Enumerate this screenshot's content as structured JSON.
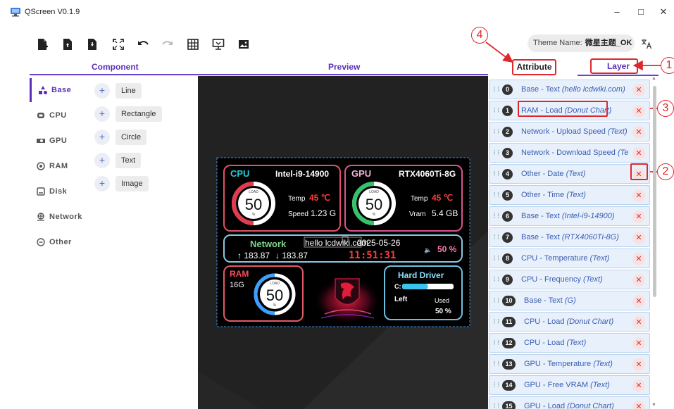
{
  "window": {
    "title": "QScreen V0.1.9",
    "minimize_glyph": "–",
    "maximize_glyph": "□",
    "close_glyph": "✕"
  },
  "toolbar": {
    "icons": [
      "new-file-icon",
      "open-file-icon",
      "save-file-icon",
      "fullscreen-icon",
      "undo-icon",
      "redo-icon",
      "grid-icon",
      "display-icon",
      "image-icon"
    ],
    "theme_label": "Theme Name:",
    "theme_value": "微星主题_OK",
    "translate_icon": "translate-icon"
  },
  "headers": {
    "component": "Component",
    "preview": "Preview",
    "attribute": "Attribute",
    "layer": "Layer"
  },
  "annotations": [
    "1",
    "2",
    "3",
    "4"
  ],
  "sidebar": {
    "items": [
      {
        "label": "Base",
        "icon": "shapes-icon"
      },
      {
        "label": "CPU",
        "icon": "cpu-icon"
      },
      {
        "label": "GPU",
        "icon": "gpu-icon"
      },
      {
        "label": "RAM",
        "icon": "ram-icon"
      },
      {
        "label": "Disk",
        "icon": "disk-icon"
      },
      {
        "label": "Network",
        "icon": "network-icon"
      },
      {
        "label": "Other",
        "icon": "other-icon"
      }
    ]
  },
  "components": {
    "plus": "+",
    "items": [
      "Line",
      "Rectangle",
      "Circle",
      "Text",
      "Image"
    ]
  },
  "preview": {
    "cpu_title": "CPU",
    "cpu_model": "Intel-i9-14900",
    "cpu_load": "50",
    "cpu_temp_label": "Temp",
    "cpu_temp_value": "45 ℃",
    "cpu_speed_label": "Speed",
    "cpu_speed_value": "1.23 G",
    "gpu_title": "GPU",
    "gpu_model": "RTX4060Ti-8G",
    "gpu_load": "50",
    "gpu_temp_label": "Temp",
    "gpu_temp_value": "45 ℃",
    "gpu_vram_label": "Vram",
    "gpu_vram_value": "5.4 GB",
    "load_label": "LOAD",
    "percent": "%",
    "network_title": "Network",
    "network_up": "↑ 183.87",
    "network_down": "↓ 183.87",
    "overlay_text": "hello lcdwiki.com",
    "date": "2025-05-26",
    "time": "11:51:31",
    "volume_value": "50 %",
    "ram_title": "RAM",
    "ram_size": "16G",
    "ram_load": "50",
    "disk_title": "Hard Driver",
    "disk_drive": "C:",
    "disk_left": "Left",
    "disk_used": "Used",
    "disk_used_value": "50 %",
    "disk_used_fraction": 0.5,
    "colors": {
      "cpu_border": "#e0506a",
      "gpu_border": "#d9538e",
      "network_border": "#89c6e6",
      "ram_border": "#e25a6a",
      "disk_border": "#6cc0e0",
      "cpu_title": "#29c9d9",
      "gpu_title": "#f3b4d1",
      "network_title": "#7ad78a",
      "ram_title": "#ff4a5a",
      "disk_title": "#8be0ff",
      "temp": "#ff3b3b",
      "time": "#ff3b3b",
      "volume": "#ff7ab0"
    }
  },
  "layers": [
    {
      "num": "0",
      "name": "Base - Text",
      "detail": "(hello lcdwiki.com)"
    },
    {
      "num": "1",
      "name": "RAM - Load",
      "detail": "(Donut Chart)"
    },
    {
      "num": "2",
      "name": "Network - Upload Speed",
      "detail": "(Text)"
    },
    {
      "num": "3",
      "name": "Network - Download Speed",
      "detail": "(Text)"
    },
    {
      "num": "4",
      "name": "Other - Date",
      "detail": "(Text)"
    },
    {
      "num": "5",
      "name": "Other - Time",
      "detail": "(Text)"
    },
    {
      "num": "6",
      "name": "Base - Text",
      "detail": "(Intel-i9-14900)"
    },
    {
      "num": "7",
      "name": "Base - Text",
      "detail": "(RTX4060Ti-8G)"
    },
    {
      "num": "8",
      "name": "CPU - Temperature",
      "detail": "(Text)"
    },
    {
      "num": "9",
      "name": "CPU - Frequency",
      "detail": "(Text)"
    },
    {
      "num": "10",
      "name": "Base - Text",
      "detail": "(G)"
    },
    {
      "num": "11",
      "name": "CPU - Load",
      "detail": "(Donut Chart)"
    },
    {
      "num": "12",
      "name": "CPU - Load",
      "detail": "(Text)"
    },
    {
      "num": "13",
      "name": "GPU - Temperature",
      "detail": "(Text)"
    },
    {
      "num": "14",
      "name": "GPU - Free VRAM",
      "detail": "(Text)"
    },
    {
      "num": "15",
      "name": "GPU - Load",
      "detail": "(Donut Chart)"
    }
  ],
  "delete_glyph": "✕",
  "grip_glyph": "⠇⠇",
  "scroll_up": "▲",
  "scroll_down": "▼"
}
